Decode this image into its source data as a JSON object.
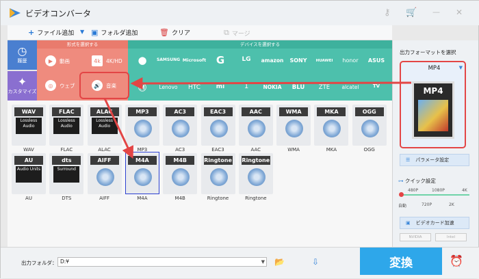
{
  "window": {
    "title": "ビデオコンバータ"
  },
  "toolbar": {
    "add_file": "ファイル追加",
    "add_folder": "フォルダ追加",
    "clear": "クリア",
    "merge": "マージ"
  },
  "left_tabs": {
    "history": "履歴",
    "custom": "カスタマイズ"
  },
  "format_panel": {
    "header": "形式を選択する",
    "video": "動画",
    "hd": "4K/HD",
    "web": "ウェブ",
    "music": "音楽"
  },
  "device_panel": {
    "header": "デバイスを選択する",
    "brands_row1": [
      "",
      "SAMSUNG",
      "Microsoft",
      "G",
      "LG",
      "amazon",
      "SONY",
      "HUAWEI",
      "honor",
      "ASUS"
    ],
    "brands_row2": [
      "",
      "Lenovo",
      "HTC",
      "mi",
      "1",
      "NOKIA",
      "BLU",
      "ZTE",
      "alcatel",
      "TV"
    ]
  },
  "formats_row1": [
    {
      "label": "WAV",
      "sub": "Lossless Audio",
      "name": "WAV"
    },
    {
      "label": "FLAC",
      "sub": "Lossless Audio",
      "name": "FLAC"
    },
    {
      "label": "ALAC",
      "sub": "Lossless Audio",
      "name": "ALAC"
    },
    {
      "label": "MP3",
      "sub": "",
      "name": "MP3"
    },
    {
      "label": "AC3",
      "sub": "",
      "name": "AC3"
    },
    {
      "label": "EAC3",
      "sub": "",
      "name": "EAC3"
    },
    {
      "label": "AAC",
      "sub": "",
      "name": "AAC"
    },
    {
      "label": "WMA",
      "sub": "",
      "name": "WMA"
    },
    {
      "label": "MKA",
      "sub": "",
      "name": "MKA"
    },
    {
      "label": "OGG",
      "sub": "",
      "name": "OGG"
    }
  ],
  "formats_row2": [
    {
      "label": "AU",
      "sub": "Audio Units",
      "name": "AU"
    },
    {
      "label": "dts",
      "sub": "Surround",
      "name": "DTS"
    },
    {
      "label": "AIFF",
      "sub": "",
      "name": "AIFF"
    },
    {
      "label": "M4A",
      "sub": "",
      "name": "M4A"
    },
    {
      "label": "M4B",
      "sub": "",
      "name": "M4B"
    },
    {
      "label": "Ringtone",
      "sub": "",
      "name": "Ringtone"
    },
    {
      "label": "Ringtone",
      "sub": "",
      "name": "Ringtone"
    }
  ],
  "right_panel": {
    "output_format_title": "出力フォーマットを選択",
    "selected_format": "MP4",
    "big_label": "MP4",
    "param_settings": "パラメータ設定",
    "quick_settings": "クイック設定",
    "scale_top": [
      "480P",
      "1080P",
      "4K"
    ],
    "scale_bottom": [
      "自動",
      "720P",
      "2K"
    ],
    "gpu_accel": "ビデオカード加速",
    "gpu_nvidia": "NVIDIA",
    "gpu_intel": "Intel"
  },
  "bottom": {
    "output_folder_label": "出力フォルダ：",
    "output_folder_value": "D:¥",
    "convert": "変換"
  },
  "colors": {
    "accent_red": "#e34545",
    "format_panel": "#ef8b7e",
    "device_panel": "#4dc0ac",
    "convert_btn": "#2ea7ea"
  }
}
